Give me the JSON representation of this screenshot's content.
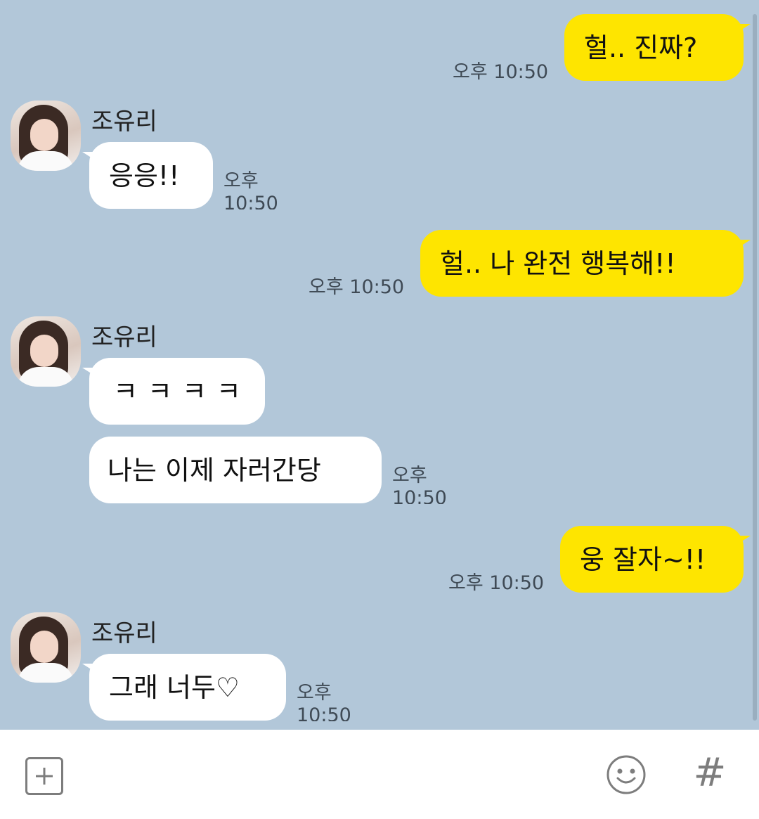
{
  "chat": {
    "sender_name": "조유리",
    "messages": [
      {
        "from": "me",
        "text": "헐.. 진짜?",
        "time": "오후 10:50"
      },
      {
        "from": "other",
        "text": "응응!!",
        "time": "오후 10:50"
      },
      {
        "from": "me",
        "text": "헐.. 나 완전 행복해!!",
        "time": "오후 10:50"
      },
      {
        "from": "other",
        "text": "ㅋㅋㅋㅋ"
      },
      {
        "from": "other",
        "text": "나는 이제 자러간당",
        "time": "오후 10:50"
      },
      {
        "from": "me",
        "text": "웅 잘자~!!",
        "time": "오후 10:50"
      },
      {
        "from": "other",
        "text": "그래 너두♡",
        "time": "오후 10:50"
      }
    ]
  },
  "input": {
    "plus_icon": "plus-icon",
    "emoji_icon": "smiley-icon",
    "hash_label": "#"
  },
  "colors": {
    "background": "#b2c7d9",
    "my_bubble": "#fee500",
    "other_bubble": "#ffffff",
    "input_bar": "#ffffff",
    "icon_gray": "#7d7d7d"
  }
}
